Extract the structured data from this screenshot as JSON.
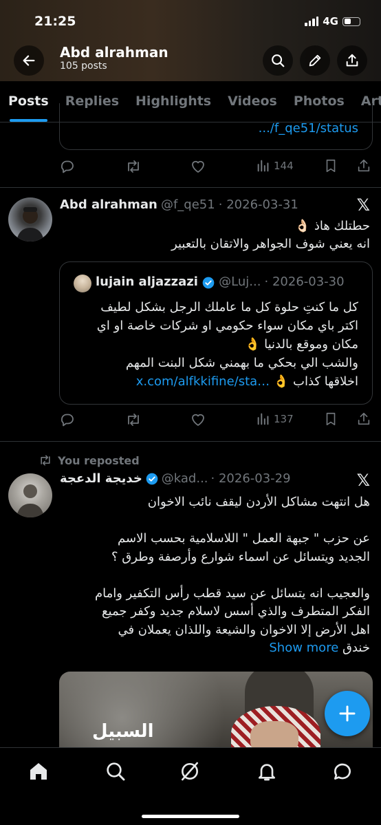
{
  "status_bar": {
    "time": "21:25",
    "network": "4G"
  },
  "header": {
    "name": "Abd alrahman",
    "posts_count": "105 posts"
  },
  "tabs": [
    {
      "label": "Posts",
      "active": true
    },
    {
      "label": "Replies"
    },
    {
      "label": "Highlights"
    },
    {
      "label": "Videos"
    },
    {
      "label": "Photos"
    },
    {
      "label": "Arti"
    }
  ],
  "post0": {
    "quote_link": ".../f_qe51/status",
    "views": "144"
  },
  "post1": {
    "author": "Abd alrahman",
    "handle": "@f_qe51",
    "date": "· 2026-03-31",
    "lines": [
      "حطتلك هاذ 👌🏻",
      "انه يعني شوف الجواهر والاتقان بالتعبير"
    ],
    "quote": {
      "author": "lujain aljazzazi",
      "handle": "@Luj...",
      "date": "· 2026-03-30",
      "lines": [
        "كل ما كنتِ حلوة كل ما عاملك الرجل بشكل لطيف",
        "اكتر باي مكان سواء حكومي او شركات خاصة او اي",
        "مكان وموقع بالدنيا 👌",
        "والشب الي بحكي ما بهمني شكل البنت المهم"
      ],
      "last_line_text": "اخلاقها كذاب 👌",
      "last_line_link": "x.com/alfkkifine/sta…"
    },
    "views": "137"
  },
  "post2": {
    "repost_label": "You reposted",
    "author": "خديجة الدعجة",
    "handle": "@kad...",
    "date": "· 2026-03-29",
    "lines": [
      "هل انتهت مشاكل الأردن ليقف نائب الاخوان",
      "",
      "عن حزب \" جبهة العمل \" اللاسلامية بحسب الاسم",
      "الجديد ويتسائل عن اسماء شوارع وأرصفة وطرق ؟",
      "",
      "والعجيب انه يتسائل عن سيد قطب رأس التكفير وامام",
      "الفكر المتطرف والذي أسس لاسلام جديد وكفر جميع",
      "اهل الأرض إلا الاخوان والشيعة واللذان يعملان في"
    ],
    "last_word": "خندق",
    "show_more": "Show more",
    "image_caption": "السبيل"
  },
  "colors": {
    "accent": "#1d9bf0",
    "text": "#e7e9ea",
    "muted": "#71767b",
    "verified": "#1d9bf0"
  }
}
